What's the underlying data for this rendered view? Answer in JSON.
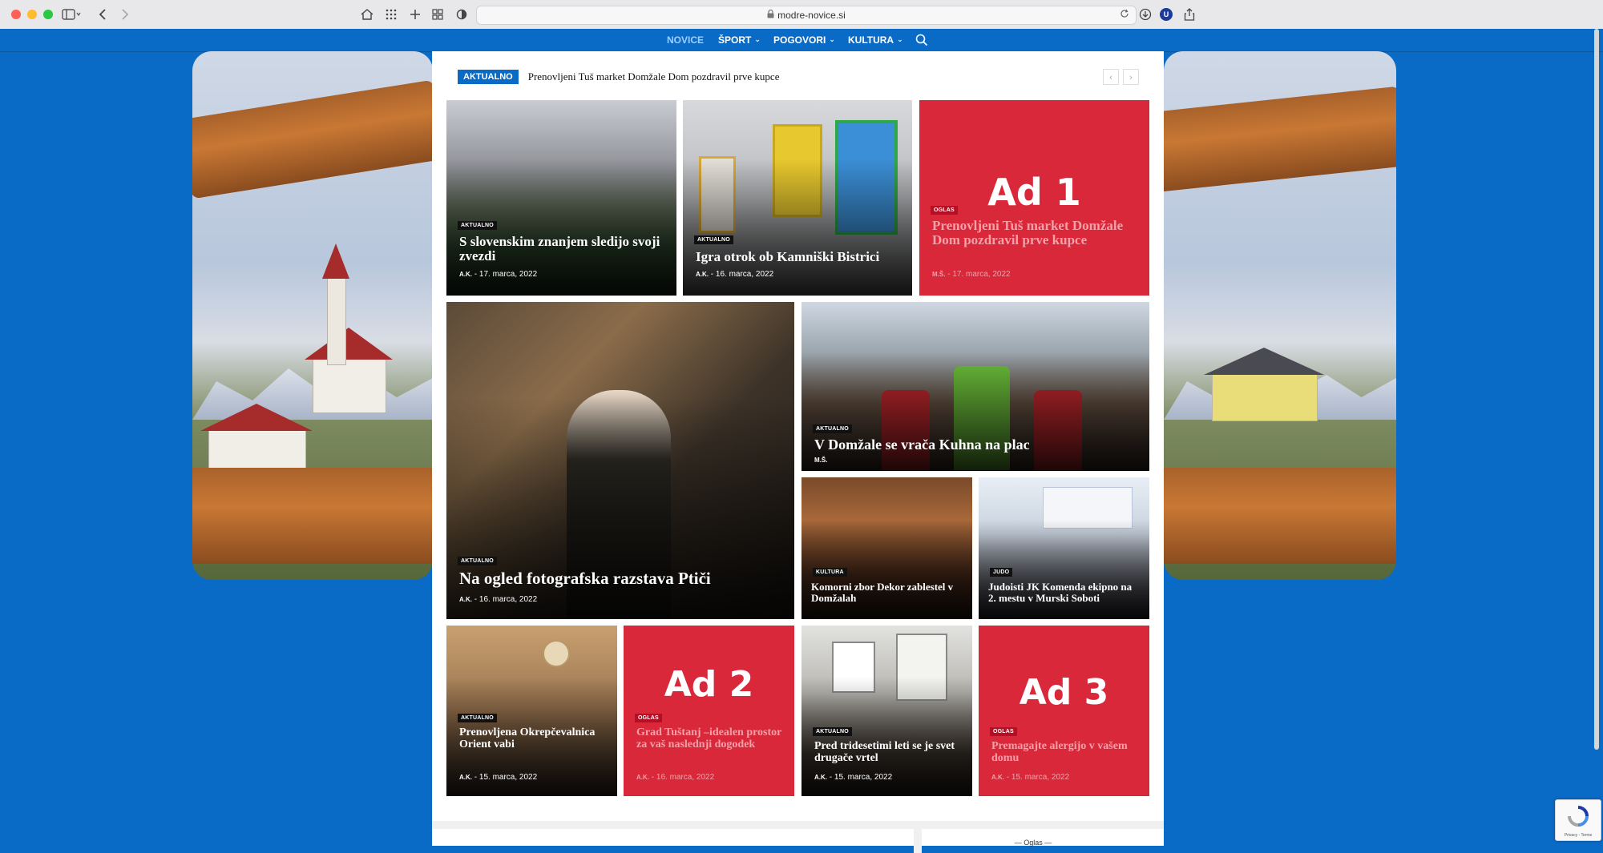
{
  "browser": {
    "url": "modre-novice.si",
    "colors": {
      "close": "#fe5f57",
      "minimize": "#febc2e",
      "maximize": "#28c840"
    },
    "icons": [
      "sidebar-icon",
      "back-icon",
      "forward-icon",
      "home-icon",
      "apps-grid-icon",
      "new-tab-icon",
      "tab-overview-icon",
      "privacy-shield-icon",
      "reload-icon",
      "download-icon",
      "profile-icon",
      "share-icon"
    ],
    "profile_initial": "U"
  },
  "nav": {
    "items": [
      {
        "label": "NOVICE",
        "active": true
      },
      {
        "label": "ŠPORT",
        "dropdown": true
      },
      {
        "label": "POGOVORI",
        "dropdown": true
      },
      {
        "label": "KULTURA",
        "dropdown": true
      }
    ]
  },
  "ticker": {
    "badge": "AKTUALNO",
    "headline": "Prenovljeni Tuš market Domžale Dom pozdravil prve kupce"
  },
  "tiles": [
    {
      "id": "t1",
      "category": "AKTUALNO",
      "title": "S slovenskim znanjem sledijo svoji zvezdi",
      "author": "A.K.",
      "date": "17. marca, 2022"
    },
    {
      "id": "t2",
      "category": "AKTUALNO",
      "title": "Igra otrok ob Kamniški Bistrici",
      "author": "A.K.",
      "date": "16. marca, 2022"
    },
    {
      "id": "t3",
      "ad": "Ad 1",
      "category": "OGLAS",
      "title": "Prenovljeni Tuš market Domžale Dom pozdravil prve kupce",
      "author": "M.Š.",
      "date": "17. marca, 2022"
    },
    {
      "id": "t4",
      "category": "AKTUALNO",
      "title": "Na ogled fotografska razstava Ptiči",
      "author": "A.K.",
      "date": "16. marca, 2022"
    },
    {
      "id": "t5",
      "category": "AKTUALNO",
      "title": "V Domžale se vrača Kuhna na plac",
      "author": "M.Š."
    },
    {
      "id": "t6",
      "category": "KULTURA",
      "title": "Komorni zbor Dekor zablestel v Domžalah"
    },
    {
      "id": "t7",
      "category": "JUDO",
      "title": "Judoisti JK Komenda ekipno na 2. mestu v Murski Soboti"
    },
    {
      "id": "t8",
      "category": "AKTUALNO",
      "title": "Prenovljena Okrepčevalnica Orient vabi",
      "author": "A.K.",
      "date": "15. marca, 2022"
    },
    {
      "id": "t9",
      "ad": "Ad 2",
      "category": "OGLAS",
      "title": "Grad Tuštanj –idealen prostor za vaš naslednji dogodek",
      "author": "A.K.",
      "date": "16. marca, 2022"
    },
    {
      "id": "t10",
      "category": "AKTUALNO",
      "title": "Pred tridesetimi leti se je svet drugače vrtel",
      "author": "A.K.",
      "date": "15. marca, 2022"
    },
    {
      "id": "t11",
      "ad": "Ad 3",
      "category": "OGLAS",
      "title": "Premagajte alergijo v vašem domu",
      "author": "A.K.",
      "date": "15. marca, 2022"
    }
  ],
  "sidebar": {
    "ad_label": "— Oglas —"
  },
  "recaptcha": {
    "footer": "Privacy - Terms"
  },
  "theme": {
    "brand_blue": "#0a6bc7",
    "ad_red": "#d8283a"
  }
}
